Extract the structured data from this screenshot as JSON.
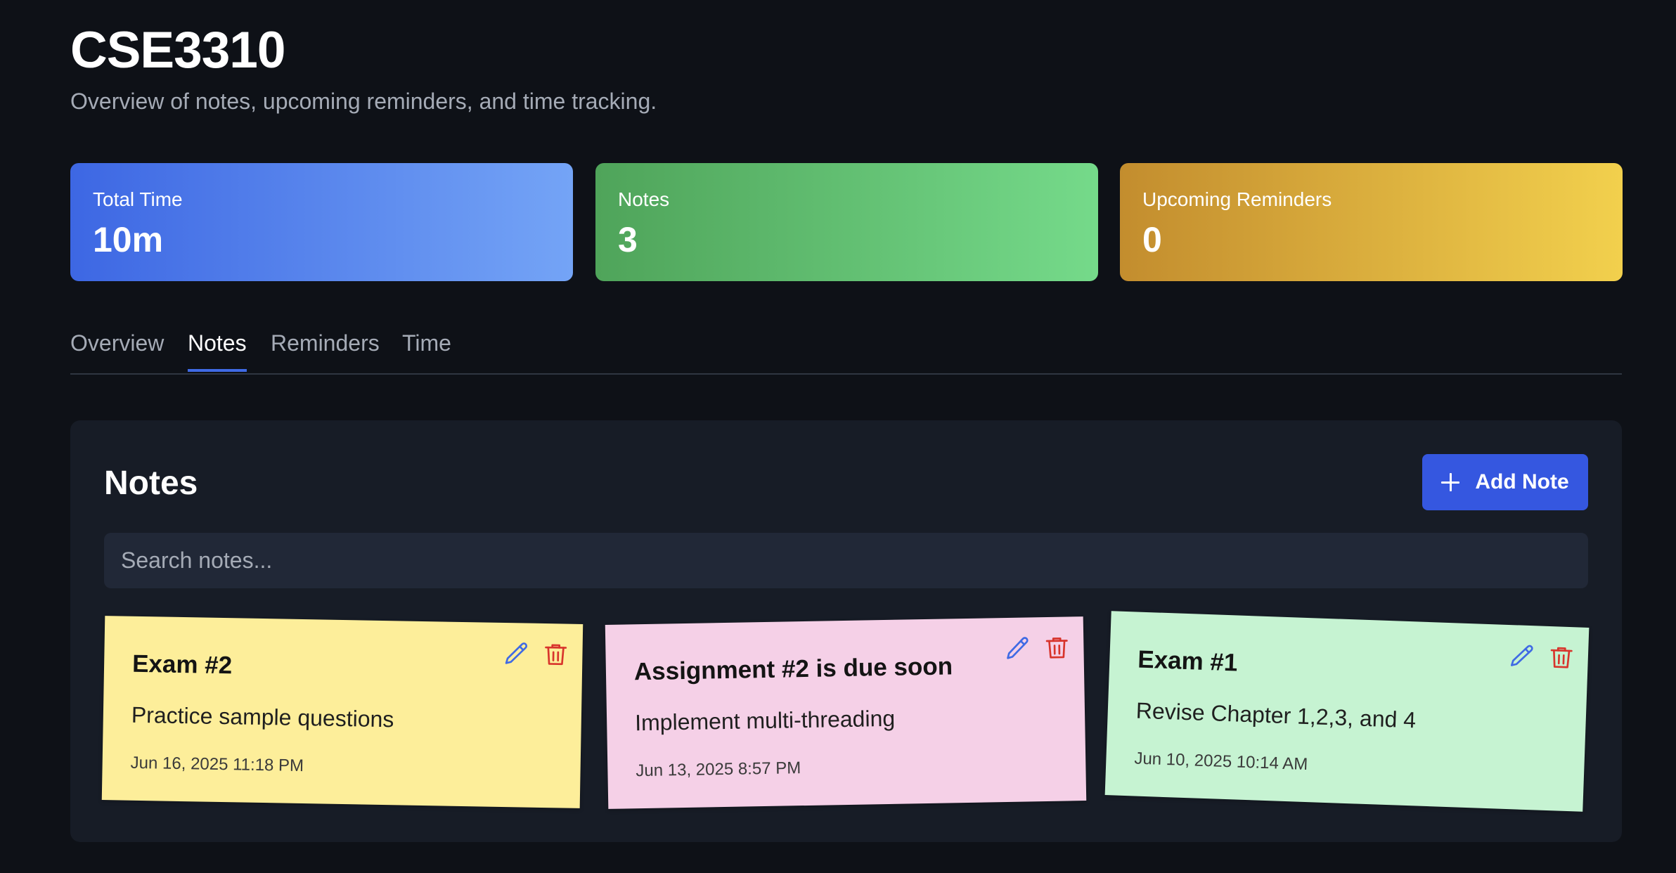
{
  "header": {
    "title": "CSE3310",
    "subtitle": "Overview of notes, upcoming reminders, and time tracking."
  },
  "stats": [
    {
      "label": "Total Time",
      "value": "10m",
      "color_start": "#3d67e3",
      "color_end": "#74a4f6"
    },
    {
      "label": "Notes",
      "value": "3",
      "color_start": "#4fa45a",
      "color_end": "#75da8a"
    },
    {
      "label": "Upcoming Reminders",
      "value": "0",
      "color_start": "#c38d2e",
      "color_end": "#f2d04d"
    }
  ],
  "tabs": [
    {
      "label": "Overview",
      "active": false
    },
    {
      "label": "Notes",
      "active": true
    },
    {
      "label": "Reminders",
      "active": false
    },
    {
      "label": "Time",
      "active": false
    }
  ],
  "notes_panel": {
    "title": "Notes",
    "add_button_label": "Add Note",
    "add_button_icon": "plus-icon",
    "search_placeholder": "Search notes...",
    "search_value": "",
    "notes": [
      {
        "title": "Exam #2",
        "body": "Practice sample questions",
        "date": "Jun 16, 2025 11:18 PM",
        "color": "#fdee9a"
      },
      {
        "title": "Assignment #2 is due soon",
        "body": "Implement multi-threading",
        "date": "Jun 13, 2025 8:57 PM",
        "color": "#f5d0e7"
      },
      {
        "title": "Exam #1",
        "body": "Revise Chapter 1,2,3, and 4",
        "date": "Jun 10, 2025 10:14 AM",
        "color": "#c6f3d2"
      }
    ],
    "note_action_icons": [
      "pencil-icon",
      "trash-icon"
    ]
  },
  "colors": {
    "background": "#0e1117",
    "panel": "#171c26",
    "accent": "#3557e0",
    "edit_icon": "#3f6ae4",
    "delete_icon": "#d8342c"
  }
}
